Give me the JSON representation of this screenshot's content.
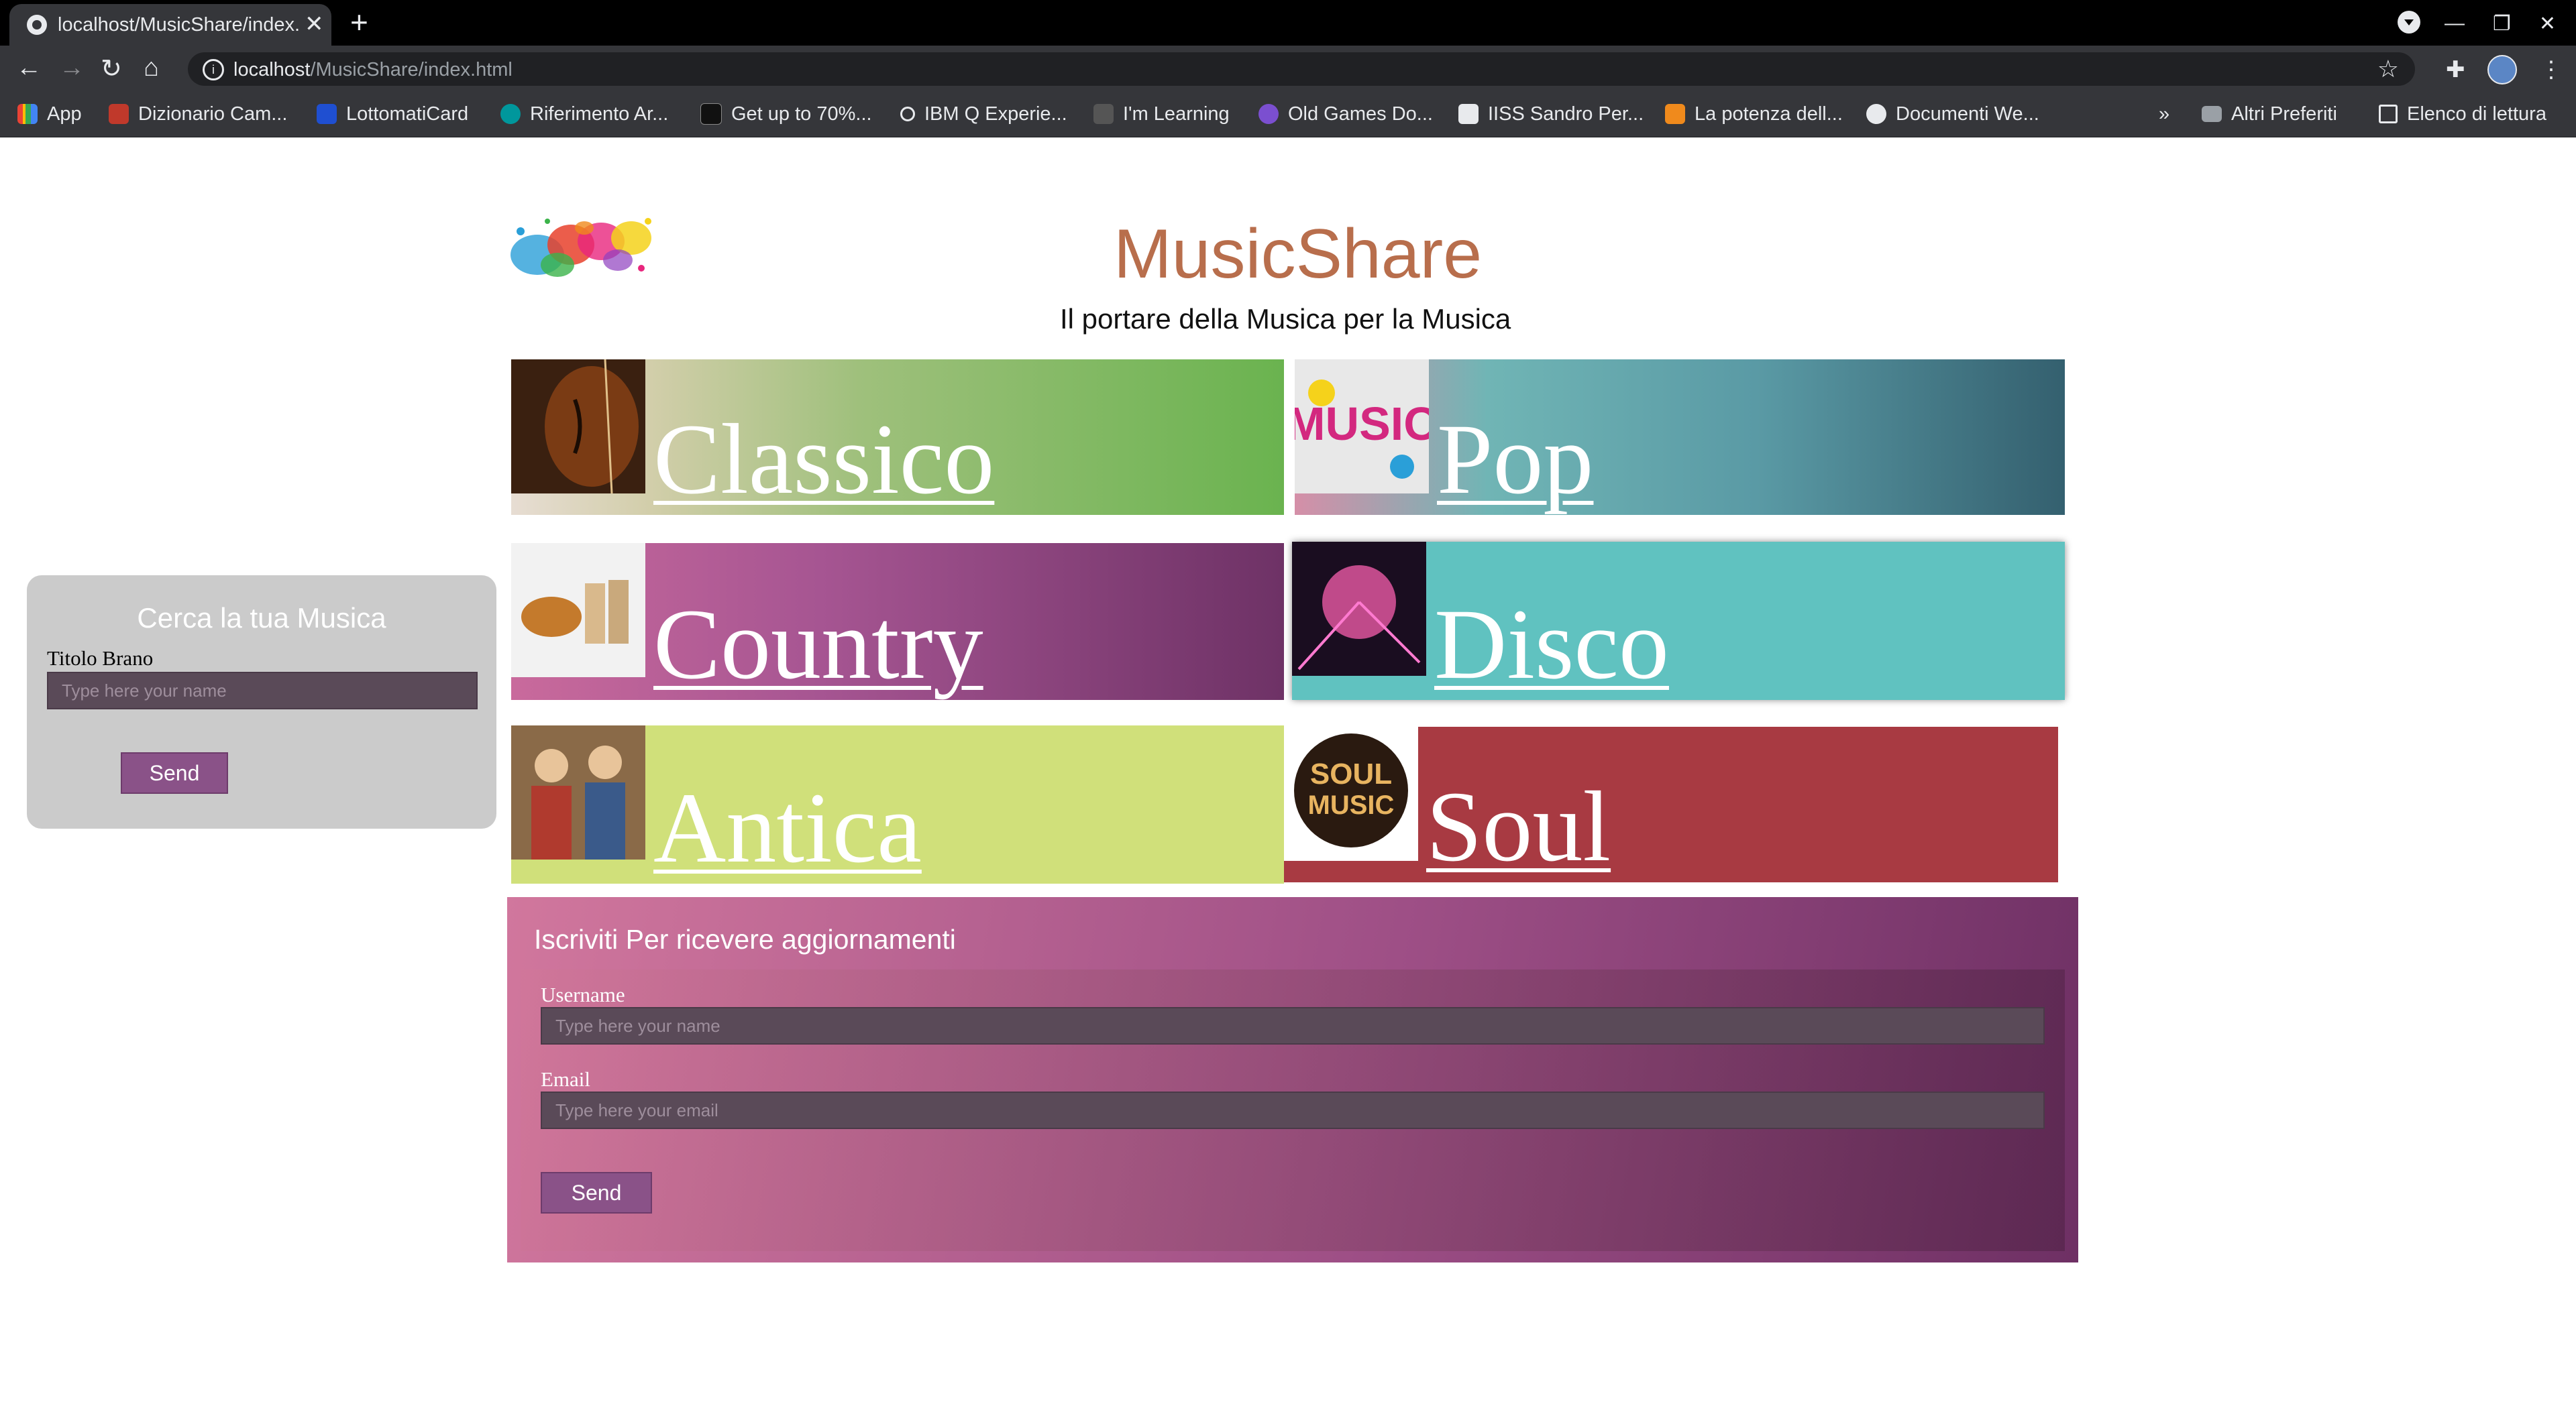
{
  "browser": {
    "tab_title": "localhost/MusicShare/index.html",
    "url_host": "localhost",
    "url_path": "/MusicShare/index.html",
    "bookmarks": [
      {
        "label": "App",
        "icon": "apps-grid-icon",
        "color": "#4285f4"
      },
      {
        "label": "Dizionario Cam...",
        "icon": "crest-icon",
        "color": "#c0392b"
      },
      {
        "label": "LottomatiCard",
        "icon": "s-logo-icon",
        "color": "#1f4fd1"
      },
      {
        "label": "Riferimento Ar...",
        "icon": "arduino-icon",
        "color": "#00979c"
      },
      {
        "label": "Get up to 70%...",
        "icon": "cdk-icon",
        "color": "#222222"
      },
      {
        "label": "IBM Q Experie...",
        "icon": "ibm-q-icon",
        "color": "#e8eaed"
      },
      {
        "label": "I'm Learning",
        "icon": "learning-icon",
        "color": "#555555"
      },
      {
        "label": "Old Games Do...",
        "icon": "old-games-icon",
        "color": "#7b4fd0"
      },
      {
        "label": "IISS Sandro Per...",
        "icon": "school-icon",
        "color": "#e8eaed"
      },
      {
        "label": "La potenza dell...",
        "icon": "orange-a-icon",
        "color": "#f08a1c"
      },
      {
        "label": "Documenti We...",
        "icon": "docs-web-icon",
        "color": "#e8eaed"
      }
    ],
    "bookmarks_overflow": "»",
    "other_bookmarks": "Altri Preferiti",
    "reading_list": "Elenco di lettura"
  },
  "site": {
    "title": "MusicShare",
    "subtitle": "Il portare della Musica per la Musica"
  },
  "genres": [
    {
      "label": "Classico",
      "image": "violin-image"
    },
    {
      "label": "Pop",
      "image": "pop-graffiti-image"
    },
    {
      "label": "Country",
      "image": "guitar-boots-image"
    },
    {
      "label": "Disco",
      "image": "disco-ball-image"
    },
    {
      "label": "Antica",
      "image": "medieval-musicians-image"
    },
    {
      "label": "Soul",
      "image": "soul-music-logo-image"
    }
  ],
  "search": {
    "title": "Cerca la tua Musica",
    "field_label": "Titolo Brano",
    "placeholder": "Type here your name",
    "button": "Send"
  },
  "subscribe": {
    "title": "Iscriviti Per ricevere aggiornamenti",
    "username_label": "Username",
    "username_placeholder": "Type here your name",
    "email_label": "Email",
    "email_placeholder": "Type here your email",
    "button": "Send"
  },
  "colors": {
    "title": "#b86e4c",
    "classico_end": "#6ab34f",
    "pop_end": "#3a6a78",
    "country_end": "#6e3266",
    "disco": "#60c2c0",
    "antica": "#d0e07a",
    "soul": "#a83a42",
    "button": "#8a5288"
  }
}
